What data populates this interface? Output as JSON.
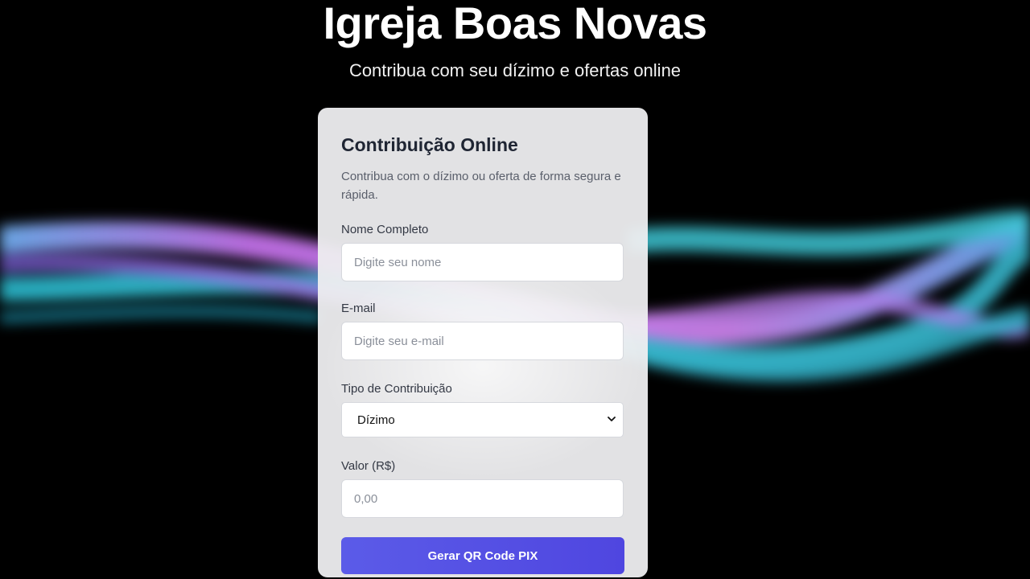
{
  "hero": {
    "title": "Igreja Boas Novas",
    "subtitle": "Contribua com seu dízimo e ofertas online"
  },
  "form": {
    "title": "Contribuição Online",
    "description": "Contribua com o dízimo ou oferta de forma segura e rápida.",
    "name_label": "Nome Completo",
    "name_placeholder": "Digite seu nome",
    "email_label": "E-mail",
    "email_placeholder": "Digite seu e-mail",
    "type_label": "Tipo de Contribuição",
    "type_selected": "Dízimo",
    "amount_label": "Valor (R$)",
    "amount_placeholder": "0,00",
    "submit_label": "Gerar QR Code PIX"
  },
  "colors": {
    "background": "#000000",
    "card": "#eeeef0",
    "button": "#5b5be8",
    "wave_teal": "#2ec6d6",
    "wave_violet": "#c77de8"
  },
  "icons": {
    "select_chevron": "chevron-down-icon"
  }
}
